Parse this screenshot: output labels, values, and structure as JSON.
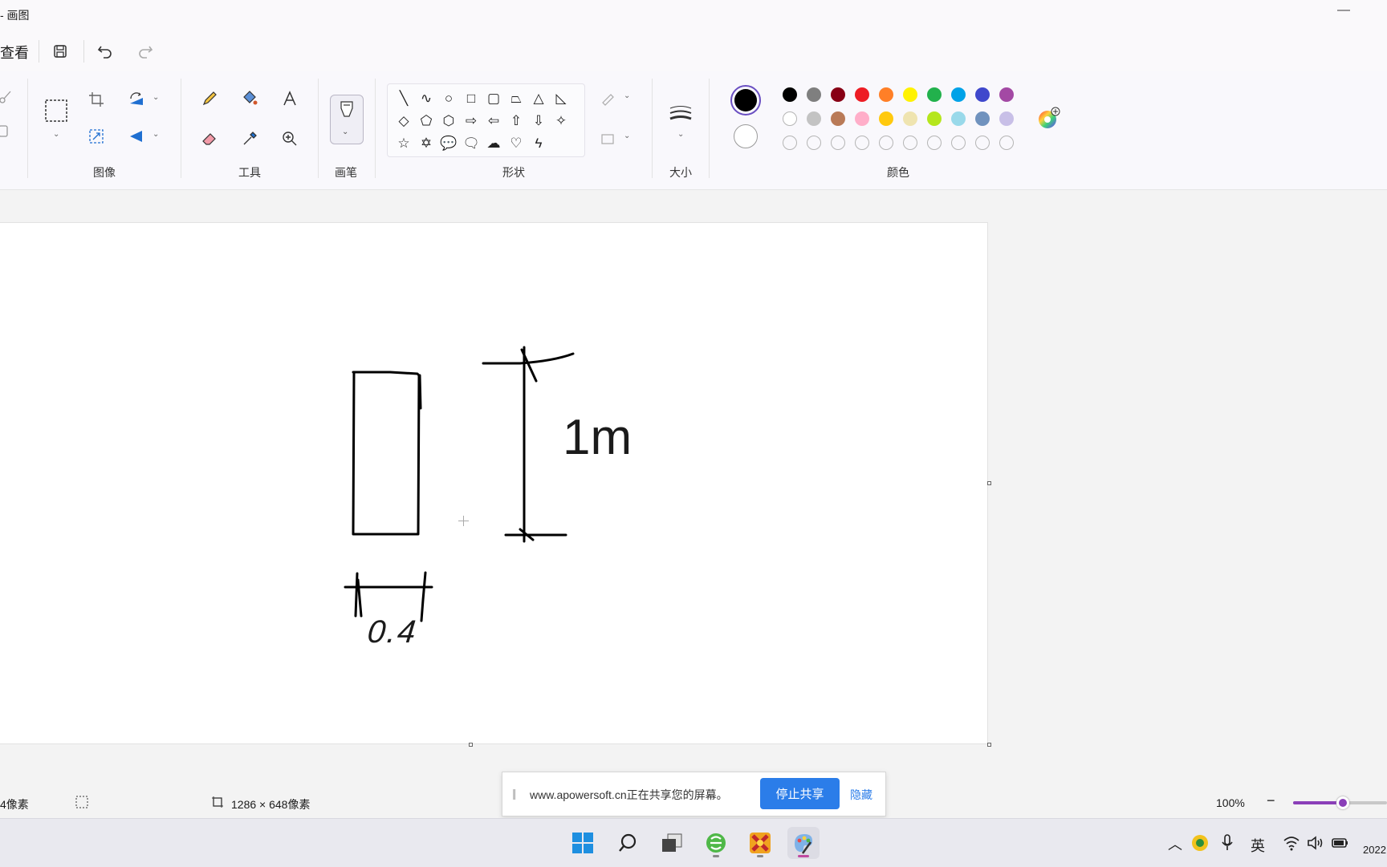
{
  "window": {
    "title": "‐ 画图",
    "minimize_glyph": "—"
  },
  "menu": {
    "view_label": "查看"
  },
  "ribbon": {
    "groups": {
      "image": "图像",
      "tools": "工具",
      "brushes": "画笔",
      "shapes": "形状",
      "size": "大小",
      "colors": "颜色"
    },
    "shapes": [
      "line-icon",
      "curve-icon",
      "oval-icon",
      "rectangle-icon",
      "rounded-rectangle-icon",
      "polygon-icon",
      "triangle-icon",
      "right-triangle-icon",
      "diamond-icon",
      "pentagon-icon",
      "hexagon-icon",
      "right-arrow-icon",
      "left-arrow-icon",
      "up-arrow-icon",
      "down-arrow-icon",
      "four-point-star-icon",
      "five-point-star-icon",
      "six-point-star-icon",
      "rounded-callout-icon",
      "oval-callout-icon",
      "cloud-callout-icon",
      "heart-icon",
      "lightning-icon"
    ],
    "shape_glyphs": [
      "╲",
      "∿",
      "○",
      "□",
      "▢",
      "⏢",
      "△",
      "◺",
      "◇",
      "⬠",
      "⬡",
      "⇨",
      "⇦",
      "⇧",
      "⇩",
      "✧",
      "☆",
      "✡",
      "💬",
      "🗨",
      "☁",
      "♡",
      "ϟ"
    ],
    "colors_row1": [
      "#000000",
      "#7f7f7f",
      "#880015",
      "#ed1c24",
      "#ff7f27",
      "#fff200",
      "#22b14c",
      "#00a2e8",
      "#3f48cc",
      "#a349a4"
    ],
    "colors_row2": [
      "#ffffff",
      "#c3c3c3",
      "#b97a57",
      "#ffaec9",
      "#ffc90e",
      "#efe4b0",
      "#b5e61d",
      "#99d9ea",
      "#7092be",
      "#c8bfe7"
    ],
    "primary_color": "#000000",
    "secondary_color": "#ffffff"
  },
  "canvas": {
    "label_width": "0.4",
    "label_height": "1m"
  },
  "status": {
    "cursor_pos": "4像素",
    "canvas_size": "1286 × 648像素",
    "zoom": "100%"
  },
  "share": {
    "message": "www.apowersoft.cn正在共享您的屏幕。",
    "stop_label": "停止共享",
    "hide_label": "隐藏"
  },
  "tray": {
    "ime": "英",
    "date_fragment": "2022"
  }
}
